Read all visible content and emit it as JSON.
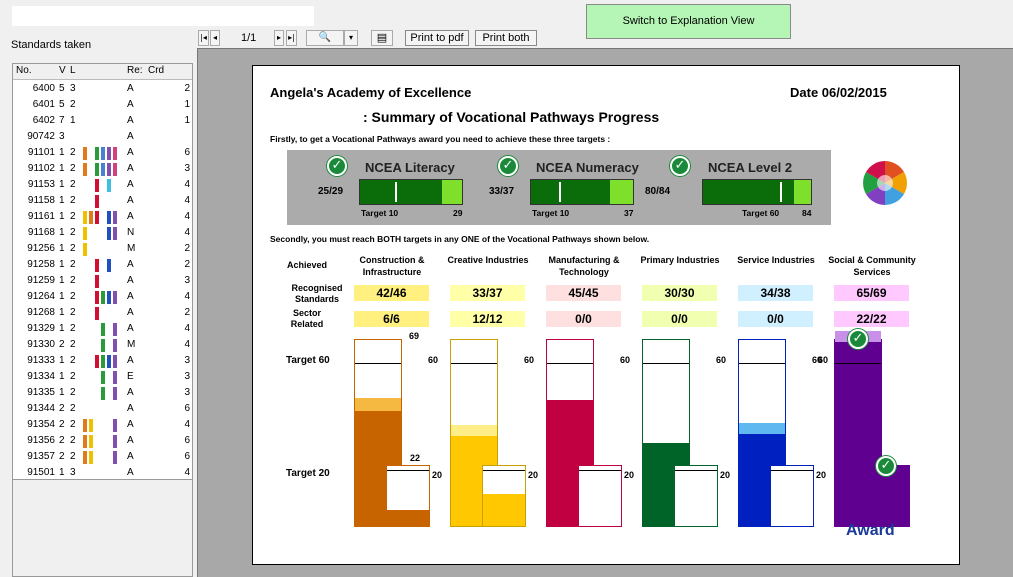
{
  "app": {
    "switch_button": "Switch to Explanation View",
    "standards_label": "Standards taken"
  },
  "toolbar": {
    "first": "|◂",
    "prev": "◂",
    "page": "1/1",
    "next": "▸",
    "last": "▸|",
    "zoom_icon": "🔍",
    "dropdown": "▾",
    "print_pdf": "Print to pdf",
    "print_both": "Print both"
  },
  "list": {
    "headers": [
      "No.",
      "V",
      "L",
      "",
      "Re:",
      "Crd"
    ],
    "rows": [
      {
        "no": "6400",
        "v": "5",
        "l": "3",
        "re": "A",
        "crd": "2",
        "bars": []
      },
      {
        "no": "6401",
        "v": "5",
        "l": "2",
        "re": "A",
        "crd": "1",
        "bars": []
      },
      {
        "no": "6402",
        "v": "7",
        "l": "1",
        "re": "A",
        "crd": "1",
        "bars": []
      },
      {
        "no": "90742",
        "v": "3",
        "l": "",
        "re": "A",
        "crd": "",
        "bars": []
      },
      {
        "no": "91101",
        "v": "1",
        "l": "2",
        "re": "A",
        "crd": "6",
        "bars": [
          "#e07a1a",
          "",
          "#2a9a3a",
          "#4b7fd0",
          "#8050b0",
          "#d24080"
        ]
      },
      {
        "no": "91102",
        "v": "1",
        "l": "2",
        "re": "A",
        "crd": "3",
        "bars": [
          "#e07a1a",
          "",
          "#2a9a3a",
          "#4b7fd0",
          "#8050b0",
          "#d24080"
        ]
      },
      {
        "no": "91153",
        "v": "1",
        "l": "2",
        "re": "A",
        "crd": "4",
        "bars": [
          "",
          "",
          "#d01030",
          "",
          "#40c0e0",
          ""
        ]
      },
      {
        "no": "91158",
        "v": "1",
        "l": "2",
        "re": "A",
        "crd": "4",
        "bars": [
          "",
          "",
          "#d01030",
          "",
          "",
          ""
        ]
      },
      {
        "no": "91161",
        "v": "1",
        "l": "2",
        "re": "A",
        "crd": "4",
        "bars": [
          "#f0c000",
          "#e07a1a",
          "#d01030",
          "",
          "#2050c0",
          "#8050b0"
        ]
      },
      {
        "no": "91168",
        "v": "1",
        "l": "2",
        "re": "N",
        "crd": "4",
        "bars": [
          "#f0c000",
          "",
          "",
          "",
          "#2050c0",
          "#8050b0"
        ]
      },
      {
        "no": "91256",
        "v": "1",
        "l": "2",
        "re": "M",
        "crd": "2",
        "bars": [
          "#f0c000",
          "",
          "",
          "",
          "",
          ""
        ]
      },
      {
        "no": "91258",
        "v": "1",
        "l": "2",
        "re": "A",
        "crd": "2",
        "bars": [
          "",
          "",
          "#d01030",
          "",
          "#2050c0",
          ""
        ]
      },
      {
        "no": "91259",
        "v": "1",
        "l": "2",
        "re": "A",
        "crd": "3",
        "bars": [
          "",
          "",
          "#d01030",
          "",
          "",
          ""
        ]
      },
      {
        "no": "91264",
        "v": "1",
        "l": "2",
        "re": "A",
        "crd": "4",
        "bars": [
          "",
          "",
          "#d01030",
          "#2a9a3a",
          "#2050c0",
          "#8050b0"
        ]
      },
      {
        "no": "91268",
        "v": "1",
        "l": "2",
        "re": "A",
        "crd": "2",
        "bars": [
          "",
          "",
          "#d01030",
          "",
          "",
          ""
        ]
      },
      {
        "no": "91329",
        "v": "1",
        "l": "2",
        "re": "A",
        "crd": "4",
        "bars": [
          "",
          "",
          "",
          "#2a9a3a",
          "",
          "#8050b0"
        ]
      },
      {
        "no": "91330",
        "v": "2",
        "l": "2",
        "re": "M",
        "crd": "4",
        "bars": [
          "",
          "",
          "",
          "#2a9a3a",
          "",
          "#8050b0"
        ]
      },
      {
        "no": "91333",
        "v": "1",
        "l": "2",
        "re": "A",
        "crd": "3",
        "bars": [
          "",
          "",
          "#d01030",
          "#2a9a3a",
          "#2050c0",
          "#8050b0"
        ]
      },
      {
        "no": "91334",
        "v": "1",
        "l": "2",
        "re": "E",
        "crd": "3",
        "bars": [
          "",
          "",
          "",
          "#2a9a3a",
          "",
          "#8050b0"
        ]
      },
      {
        "no": "91335",
        "v": "1",
        "l": "2",
        "re": "A",
        "crd": "3",
        "bars": [
          "",
          "",
          "",
          "#2a9a3a",
          "",
          "#8050b0"
        ]
      },
      {
        "no": "91344",
        "v": "2",
        "l": "2",
        "re": "A",
        "crd": "6",
        "bars": []
      },
      {
        "no": "91354",
        "v": "2",
        "l": "2",
        "re": "A",
        "crd": "4",
        "bars": [
          "#e07a1a",
          "#f0c000",
          "",
          "",
          "",
          "#8050b0"
        ]
      },
      {
        "no": "91356",
        "v": "2",
        "l": "2",
        "re": "A",
        "crd": "6",
        "bars": [
          "#e07a1a",
          "#f0c000",
          "",
          "",
          "",
          "#8050b0"
        ]
      },
      {
        "no": "91357",
        "v": "2",
        "l": "2",
        "re": "A",
        "crd": "6",
        "bars": [
          "#e07a1a",
          "#f0c000",
          "",
          "",
          "",
          "#8050b0"
        ]
      },
      {
        "no": "91501",
        "v": "1",
        "l": "3",
        "re": "A",
        "crd": "4",
        "bars": []
      }
    ]
  },
  "report": {
    "school": "Angela's Academy of Excellence",
    "date": "Date 06/02/2015",
    "title": ":  Summary of Vocational Pathways Progress",
    "intro1": "Firstly, to get a Vocational Pathways award you need to achieve these three targets :",
    "intro2": "Secondly, you must reach BOTH targets in any ONE of the Vocational Pathways shown below.",
    "targets": [
      {
        "name": "NCEA Literacy",
        "score": "25/29",
        "target_label": "Target 10",
        "max": "29",
        "fill": 0.92,
        "mark": 0.34
      },
      {
        "name": "NCEA Numeracy",
        "score": "33/37",
        "target_label": "Target 10",
        "max": "37",
        "fill": 0.89,
        "mark": 0.27
      },
      {
        "name": "NCEA Level 2",
        "score": "80/84",
        "target_label": "Target 60",
        "max": "84",
        "fill": 0.95,
        "mark": 0.71
      }
    ],
    "row_labels": {
      "achieved": "Achieved",
      "recognised": "Recognised Standards",
      "sector": "Sector Related",
      "target60": "Target 60",
      "target20": "Target 20"
    },
    "award": "Award",
    "pathways": [
      {
        "name": "Construction & Infrastructure",
        "rec": "42/46",
        "sec": "6/6",
        "rec_bg": "#fff080",
        "sec_bg": "#fff080",
        "color": "#c86400",
        "accent": "#f5b840",
        "big_max": "69",
        "big_t": "",
        "small_label": "22",
        "small_t": "20",
        "big_fill": 0.61,
        "big_accent": 0.07,
        "small_fill": 0.27,
        "small_border": "#c86400",
        "border": "#c86400"
      },
      {
        "name": "Creative Industries",
        "rec": "33/37",
        "sec": "12/12",
        "rec_bg": "#ffffa8",
        "sec_bg": "#ffffa8",
        "color": "#ffc800",
        "accent": "#ffee88",
        "big_max": "",
        "big_t": "60",
        "small_label": "",
        "small_t": "20",
        "big_fill": 0.48,
        "big_accent": 0.06,
        "small_fill": 0.53,
        "small_border": "#c8a000",
        "border": "#c8a000"
      },
      {
        "name": "Manufacturing & Technology",
        "rec": "45/45",
        "sec": "0/0",
        "rec_bg": "#ffe0e0",
        "sec_bg": "#ffe0e0",
        "color": "#c00040",
        "accent": "#c00040",
        "big_max": "",
        "big_t": "60",
        "small_label": "",
        "small_t": "20",
        "big_fill": 0.67,
        "big_accent": 0,
        "small_fill": 0,
        "small_border": "#c00040",
        "border": "#c00040"
      },
      {
        "name": "Primary Industries",
        "rec": "30/30",
        "sec": "0/0",
        "rec_bg": "#f0ffb0",
        "sec_bg": "#f0ffb0",
        "color": "#006428",
        "accent": "#006428",
        "big_max": "",
        "big_t": "60",
        "small_label": "",
        "small_t": "20",
        "big_fill": 0.44,
        "big_accent": 0,
        "small_fill": 0,
        "small_border": "#006428",
        "border": "#006428"
      },
      {
        "name": "Service Industries",
        "rec": "34/38",
        "sec": "0/0",
        "rec_bg": "#d0f0ff",
        "sec_bg": "#d0f0ff",
        "color": "#0020c0",
        "accent": "#60b8f0",
        "big_max": "",
        "big_t": "60",
        "small_label": "",
        "small_t": "20",
        "big_fill": 0.49,
        "big_accent": 0.06,
        "small_fill": 0,
        "small_border": "#0020c0",
        "border": "#0020c0"
      },
      {
        "name": "Social & Community Services",
        "rec": "65/69",
        "sec": "22/22",
        "rec_bg": "#ffc8ff",
        "sec_bg": "#ffc8ff",
        "color": "#600090",
        "accent": "#c890e8",
        "big_max": "",
        "big_t": "60",
        "small_label": "",
        "small_t": "",
        "big_fill": 0.98,
        "big_accent": 0.06,
        "small_fill": 1,
        "small_border": "#600090",
        "border": "#600090"
      }
    ]
  }
}
